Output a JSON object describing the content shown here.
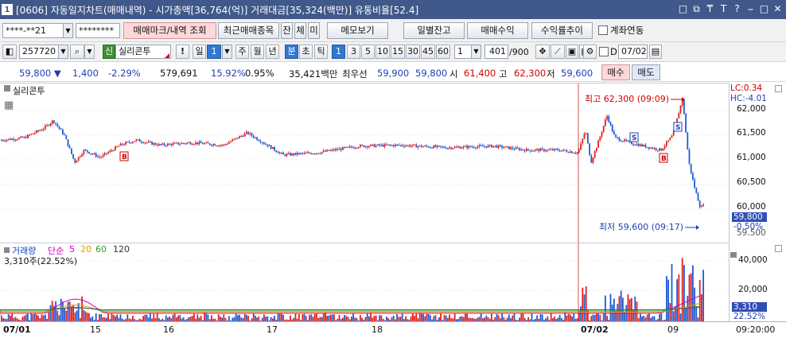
{
  "title": {
    "num": "1",
    "text": "[0606] 자동일지차트(매매내역) - 시가총액[36,764(억)] 거래대금[35,324(백만)] 유통비율[52.4]"
  },
  "title_buttons": [
    "□",
    "⧉",
    "₸",
    "T",
    "?",
    "⎯",
    "□",
    "✕"
  ],
  "toolbar1": {
    "account": "****-**21",
    "password": "********",
    "btn_mark": "매매마크/내역 조회",
    "btn_recent": "최근매매종목",
    "btn_jan": "잔",
    "btn_che": "체",
    "btn_mi": "미",
    "btn_memo": "메모보기",
    "btn_daily": "일별잔고",
    "btn_profit": "매매수익",
    "btn_rate": "수익률추이",
    "chk_link": "계좌연동"
  },
  "toolbar2": {
    "code": "257720",
    "sin": "신",
    "name": "실리콘투",
    "excl": "!",
    "period_label": "일",
    "period_value": "1",
    "periods": [
      "주",
      "월",
      "년",
      "분",
      "초",
      "틱"
    ],
    "selected_period": "분",
    "intervals": [
      "1",
      "3",
      "5",
      "10",
      "15",
      "30",
      "45",
      "60"
    ],
    "selected_interval": "1",
    "count_value": "1",
    "count_display": "401",
    "count_max": "/900",
    "d_label": "D",
    "date": "07/02"
  },
  "quote": {
    "price": "59,800 ▼",
    "change": "1,400",
    "change_pct": "-2.29%",
    "volume": "579,691",
    "ratio": "15.92%",
    "turnover_pct": "0.95%",
    "amount": "35,421백만",
    "best": "최우선",
    "ask": "59,900",
    "bid": "59,800",
    "open_label": "시",
    "open": "61,400",
    "high_label": "고",
    "high": "62,300",
    "low_label": "저",
    "low": "59,600",
    "buy_btn": "매수",
    "sell_btn": "매도"
  },
  "price_panel": {
    "label": "실리콘투",
    "lc": "LC:0.34",
    "hc": "HC:-4.01",
    "high_note": "최고 62,300 (09:09)",
    "low_note": "최저 59,600 (09:17)",
    "current": "59,800",
    "current_pct": "-0.50%",
    "cut_label": "59,500",
    "ticks": [
      "62,000",
      "61,500",
      "61,000",
      "60,500",
      "60,000"
    ]
  },
  "volume_panel": {
    "label": "거래량",
    "ma_label": "단순",
    "ma": [
      "5",
      "20",
      "60",
      "120"
    ],
    "ma_colors": [
      "#cc00cc",
      "#e0a000",
      "#2aa02a",
      "#333333"
    ],
    "value": "3,310주(22.52%)",
    "ticks": [
      "40,000",
      "20,000"
    ],
    "current": "3,310",
    "current_pct": "22.52%"
  },
  "dates": {
    "d0701": "07/01",
    "d15": "15",
    "d16": "16",
    "d17": "17",
    "d18": "18",
    "d0702": "07/02",
    "d09": "09",
    "time": "09:20:00"
  },
  "colors": {
    "up": "#e02020",
    "down": "#1e5bd6",
    "title": "#40598a",
    "accent": "#2f4eb6"
  }
}
